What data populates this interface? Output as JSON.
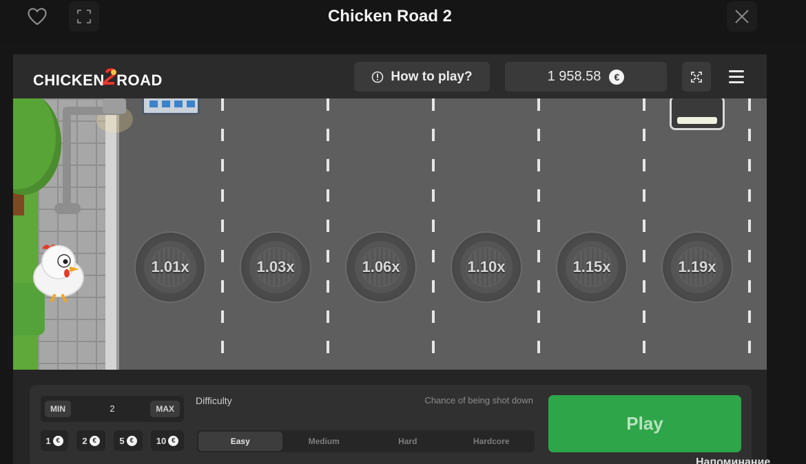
{
  "modal": {
    "title": "Chicken Road 2",
    "favorite_icon": "heart-icon",
    "fullscreen_icon": "expand-icon",
    "close_icon": "close-icon"
  },
  "game_header": {
    "logo_text_left": "CHICKEN",
    "logo_number": "2",
    "logo_text_right": "ROAD",
    "how_to_play_label": "How to play?",
    "info_icon": "info-icon",
    "balance": "1 958.58",
    "currency_symbol": "€",
    "expand_icon": "expand-icon",
    "menu_icon": "hamburger-menu-icon"
  },
  "lanes": {
    "multipliers": [
      "1.01x",
      "1.03x",
      "1.06x",
      "1.10x",
      "1.15x",
      "1.19x"
    ]
  },
  "controls": {
    "min_label": "MIN",
    "max_label": "MAX",
    "bet_value": "2",
    "quick_bets": [
      "1",
      "2",
      "5",
      "10"
    ],
    "difficulty_label": "Difficulty",
    "chance_label": "Chance of being shot down",
    "difficulty_options": [
      "Easy",
      "Medium",
      "Hard",
      "Hardcore"
    ],
    "selected_difficulty": "Easy",
    "play_label": "Play"
  },
  "overlay_corner_text": "Напоминание",
  "colors": {
    "play_green": "#2fa54a",
    "logo_red": "#e8392f",
    "background": "#161616"
  }
}
